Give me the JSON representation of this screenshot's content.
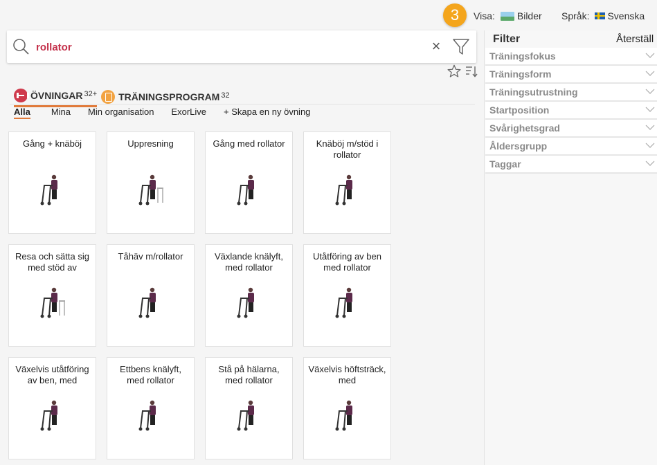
{
  "topbar": {
    "step": "3",
    "view_label": "Visa:",
    "view_value": "Bilder",
    "lang_label": "Språk:",
    "lang_value": "Svenska"
  },
  "search": {
    "value": "rollator",
    "placeholder": ""
  },
  "tabs": {
    "exercises_label": "ÖVNINGAR",
    "exercises_count": "32+",
    "programs_label": "TRÄNINGSPROGRAM",
    "programs_count": "32"
  },
  "subtabs": [
    "Alla",
    "Mina",
    "Min organisation",
    "ExorLive",
    "+ Skapa en ny övning"
  ],
  "cards": [
    "Gång + knäböj",
    "Uppresning",
    "Gång med rollator",
    "Knäböj m/stöd i rollator",
    "Resa och sätta sig med stöd av",
    "Tåhäv m/rollator",
    "Växlande knälyft, med rollator",
    "Utåtföring av ben med rollator",
    "Växelvis utåtföring av ben, med",
    "Ettbens knälyft, med rollator",
    "Stå på hälarna, med rollator",
    "Växelvis höftsträck, med"
  ],
  "filter": {
    "title": "Filter",
    "reset": "Återställ",
    "items": [
      "Träningsfokus",
      "Träningsform",
      "Träningsutrustning",
      "Startposition",
      "Svårighetsgrad",
      "Åldersgrupp",
      "Taggar"
    ]
  },
  "colors": {
    "accent": "#e07a3a",
    "search_text": "#c4314b",
    "badge": "#f4a51c"
  }
}
